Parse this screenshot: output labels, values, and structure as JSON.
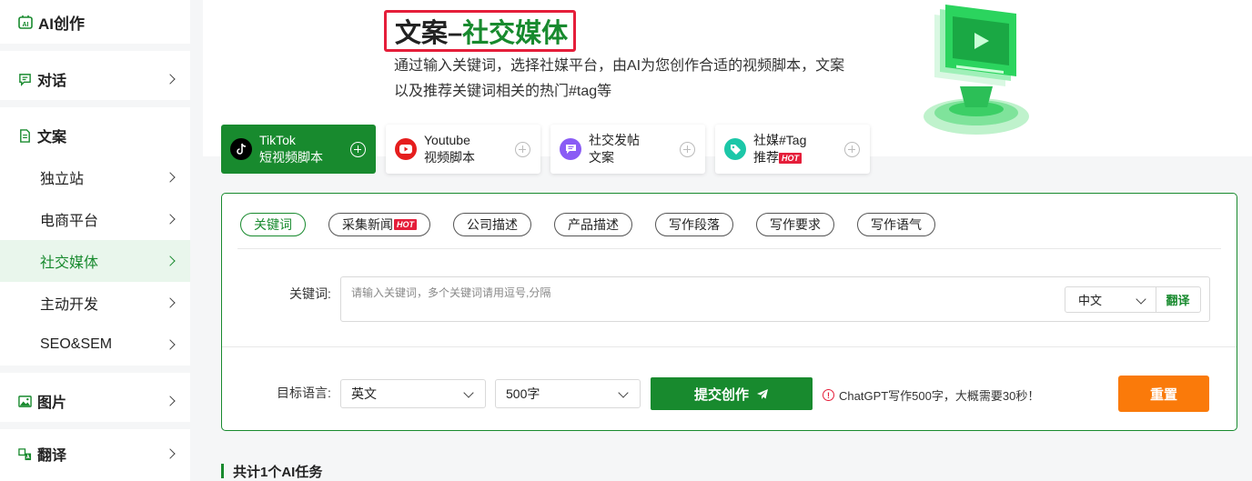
{
  "sidebar": {
    "header": "AI创作",
    "items": [
      {
        "label": "对话"
      },
      {
        "label": "文案"
      },
      {
        "label": "独立站"
      },
      {
        "label": "电商平台"
      },
      {
        "label": "社交媒体"
      },
      {
        "label": "主动开发"
      },
      {
        "label": "SEO&SEM"
      },
      {
        "label": "图片"
      },
      {
        "label": "翻译"
      }
    ]
  },
  "hero": {
    "title_part1": "文案–",
    "title_part2": "社交媒体",
    "description": "通过输入关键词，选择社媒平台，由AI为您创作合适的视频脚本，文案以及推荐关键词相关的热门#tag等"
  },
  "cards": [
    {
      "line1": "TikTok",
      "line2": "短视频脚本",
      "icon": "tiktok-icon"
    },
    {
      "line1": "Youtube",
      "line2": "视频脚本",
      "icon": "youtube-icon"
    },
    {
      "line1": "社交发帖",
      "line2": "文案",
      "icon": "chat-icon"
    },
    {
      "line1": "社媒#Tag",
      "line2": "推荐",
      "badge": "HOT",
      "icon": "tag-icon"
    }
  ],
  "tabs": [
    {
      "label": "关键词"
    },
    {
      "label": "采集新闻",
      "badge": "HOT"
    },
    {
      "label": "公司描述"
    },
    {
      "label": "产品描述"
    },
    {
      "label": "写作段落"
    },
    {
      "label": "写作要求"
    },
    {
      "label": "写作语气"
    }
  ],
  "form": {
    "keyword_label": "关键词:",
    "keyword_placeholder": "请输入关键词，多个关键词请用逗号,分隔",
    "input_lang": "中文",
    "translate_label": "翻译",
    "target_lang_label": "目标语言:",
    "target_lang": "英文",
    "word_count": "500字",
    "submit_label": "提交创作",
    "notice": "ChatGPT写作500字，大概需要30秒！",
    "reset_label": "重置"
  },
  "tasks": {
    "summary": "共计1个AI任务"
  },
  "colors": {
    "brand_green": "#188a2e",
    "hot_red": "#e51e3a",
    "reset_orange": "#fa7a0a"
  }
}
